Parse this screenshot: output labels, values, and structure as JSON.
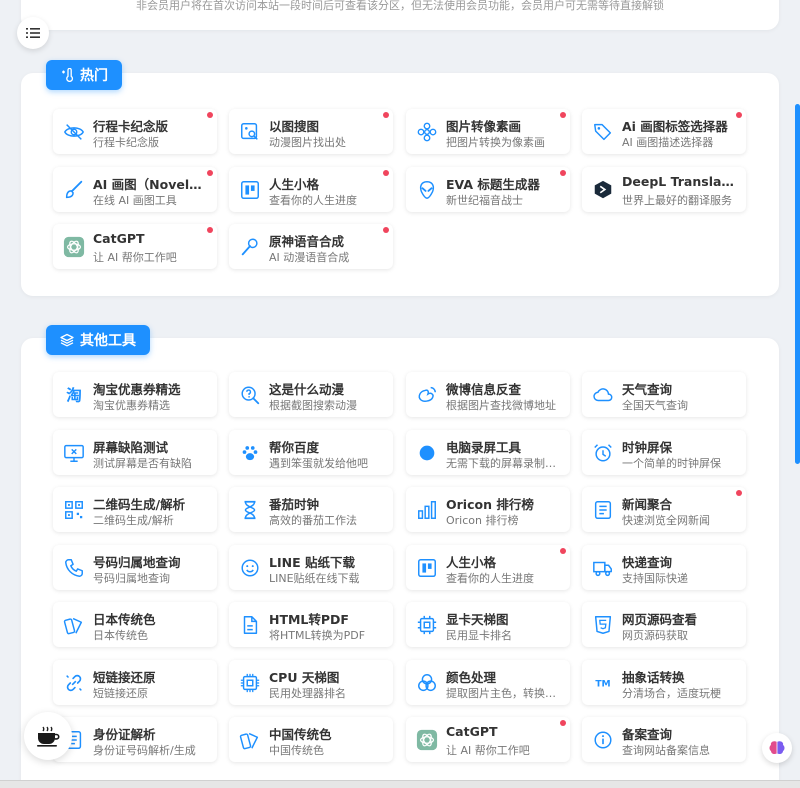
{
  "notice": "非会员用户将在首次访问本站一段时间后可查看该分区，但无法使用会员功能，会员用户可无需等待直接解锁",
  "hot": {
    "label": "热门",
    "cards": [
      {
        "title": "行程卡纪念版",
        "desc": "行程卡纪念版",
        "icon": "eye-off-icon",
        "dot": true
      },
      {
        "title": "以图搜图",
        "desc": "动漫图片找出处",
        "icon": "image-search-icon",
        "dot": true
      },
      {
        "title": "图片转像素画",
        "desc": "把图片转换为像素画",
        "icon": "flower-icon",
        "dot": true
      },
      {
        "title": "Ai 画图标签选择器",
        "desc": "AI 画图描述选择器",
        "icon": "tags-icon",
        "dot": true
      },
      {
        "title": "AI 画图（NovelAI）",
        "desc": "在线 AI 画图工具",
        "icon": "brush-icon",
        "dot": true
      },
      {
        "title": "人生小格",
        "desc": "查看你的人生进度",
        "icon": "board-icon",
        "dot": true
      },
      {
        "title": "EVA 标题生成器",
        "desc": "新世纪福音战士",
        "icon": "alien-icon",
        "dot": true
      },
      {
        "title": "DeepL Translator",
        "desc": "世界上最好的翻译服务",
        "icon": "deepl-icon",
        "dot": false
      },
      {
        "title": "CatGPT",
        "desc": "让 AI 帮你工作吧",
        "icon": "openai-icon",
        "dot": true
      },
      {
        "title": "原神语音合成",
        "desc": "AI 动漫语音合成",
        "icon": "wand-icon",
        "dot": true
      }
    ]
  },
  "tools": {
    "label": "其他工具",
    "cards": [
      {
        "title": "淘宝优惠券精选",
        "desc": "淘宝优惠券精选",
        "icon": "taobao-icon",
        "dot": false
      },
      {
        "title": "这是什么动漫",
        "desc": "根据截图搜索动漫",
        "icon": "question-search-icon",
        "dot": false
      },
      {
        "title": "微博信息反查",
        "desc": "根据图片查找微博地址",
        "icon": "weibo-icon",
        "dot": false
      },
      {
        "title": "天气查询",
        "desc": "全国天气查询",
        "icon": "cloud-icon",
        "dot": false
      },
      {
        "title": "屏幕缺陷测试",
        "desc": "测试屏幕是否有缺陷",
        "icon": "monitor-x-icon",
        "dot": false
      },
      {
        "title": "帮你百度",
        "desc": "遇到笨蛋就发给他吧",
        "icon": "paw-icon",
        "dot": false
      },
      {
        "title": "电脑录屏工具",
        "desc": "无需下载的屏幕录制工具",
        "icon": "record-dot-icon",
        "dot": false
      },
      {
        "title": "时钟屏保",
        "desc": "一个简单的时钟屏保",
        "icon": "alarm-clock-icon",
        "dot": false
      },
      {
        "title": "二维码生成/解析",
        "desc": "二维码生成/解析",
        "icon": "qrcode-icon",
        "dot": false
      },
      {
        "title": "番茄时钟",
        "desc": "高效的番茄工作法",
        "icon": "hourglass-icon",
        "dot": false
      },
      {
        "title": "Oricon 排行榜",
        "desc": "Oricon 排行榜",
        "icon": "bar-chart-icon",
        "dot": false
      },
      {
        "title": "新闻聚合",
        "desc": "快速浏览全网新闻",
        "icon": "news-icon",
        "dot": true
      },
      {
        "title": "号码归属地查询",
        "desc": "号码归属地查询",
        "icon": "phone-icon",
        "dot": false
      },
      {
        "title": "LINE 贴纸下载",
        "desc": "LINE贴纸在线下载",
        "icon": "smile-icon",
        "dot": false
      },
      {
        "title": "人生小格",
        "desc": "查看你的人生进度",
        "icon": "board-icon",
        "dot": true
      },
      {
        "title": "快递查询",
        "desc": "支持国际快递",
        "icon": "truck-icon",
        "dot": false
      },
      {
        "title": "日本传统色",
        "desc": "日本传统色",
        "icon": "swatch-icon",
        "dot": false
      },
      {
        "title": "HTML转PDF",
        "desc": "将HTML转换为PDF",
        "icon": "file-icon",
        "dot": false
      },
      {
        "title": "显卡天梯图",
        "desc": "民用显卡排名",
        "icon": "gpu-icon",
        "dot": false
      },
      {
        "title": "网页源码查看",
        "desc": "网页源码获取",
        "icon": "html5-icon",
        "dot": false
      },
      {
        "title": "短链接还原",
        "desc": "短链接还原",
        "icon": "link-icon",
        "dot": false
      },
      {
        "title": "CPU 天梯图",
        "desc": "民用处理器排名",
        "icon": "cpu-icon",
        "dot": false
      },
      {
        "title": "颜色处理",
        "desc": "提取图片主色，转换颜色格式",
        "icon": "color-circles-icon",
        "dot": false
      },
      {
        "title": "抽象话转换",
        "desc": "分清场合，适度玩梗",
        "icon": "tm-icon",
        "dot": false
      },
      {
        "title": "身份证解析",
        "desc": "身份证号码解析/生成",
        "icon": "id-card-icon",
        "dot": false
      },
      {
        "title": "中国传统色",
        "desc": "中国传统色",
        "icon": "swatch-icon",
        "dot": false
      },
      {
        "title": "CatGPT",
        "desc": "让 AI 帮你工作吧",
        "icon": "openai-icon",
        "dot": true
      },
      {
        "title": "备案查询",
        "desc": "查询网站备案信息",
        "icon": "info-icon",
        "dot": false
      }
    ]
  },
  "colors": {
    "accent": "#1e90ff",
    "dot": "#f0455d"
  }
}
